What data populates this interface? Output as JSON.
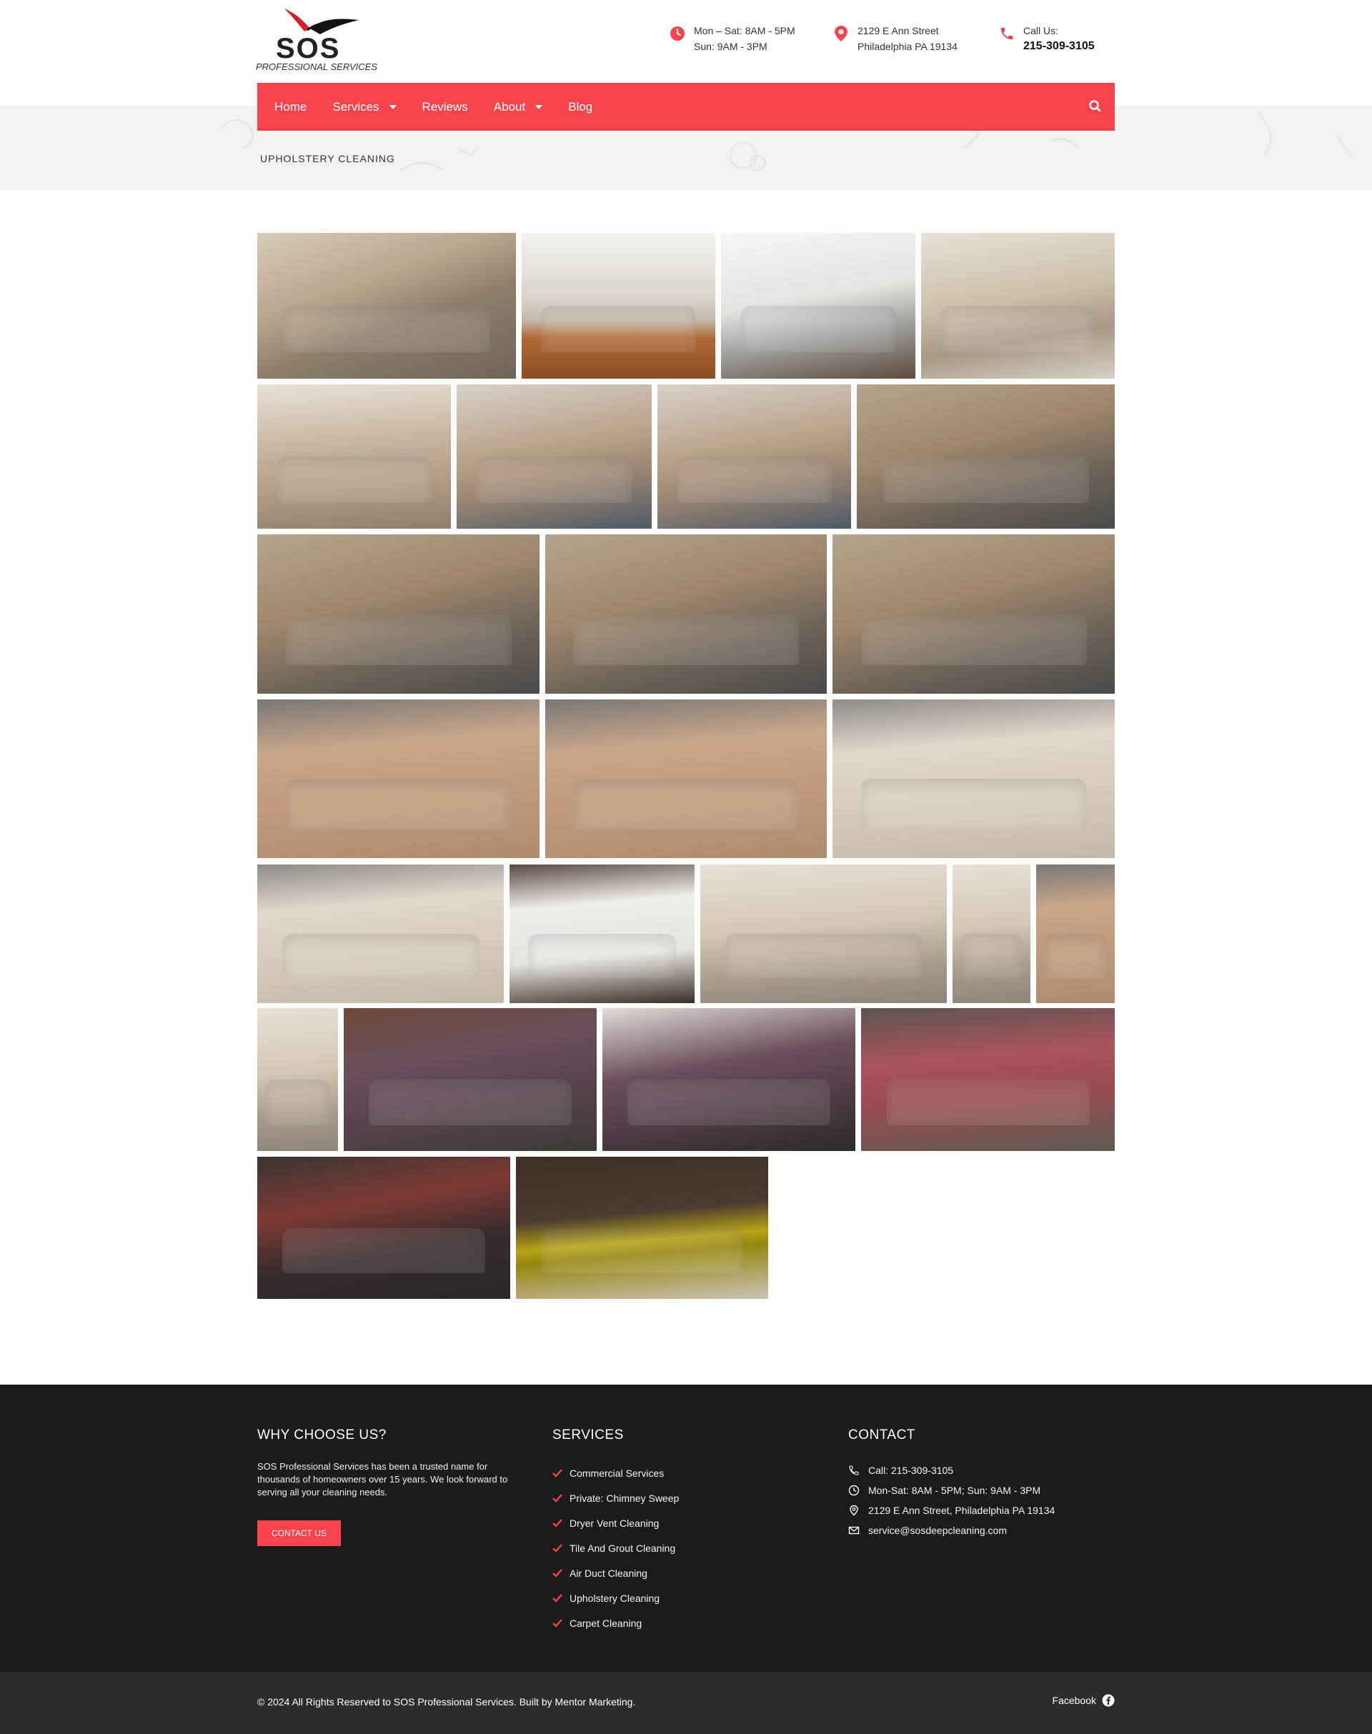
{
  "brand": {
    "name": "SOS",
    "tagline": "PROFESSIONAL SERVICES",
    "accent": "#f7434b"
  },
  "header": {
    "hours": {
      "line1": "Mon – Sat: 8AM - 5PM",
      "line2": "Sun: 9AM - 3PM",
      "icon": "clock-icon"
    },
    "address": {
      "line1": "2129 E Ann Street",
      "line2": "Philadelphia PA 19134",
      "icon": "map-pin-icon"
    },
    "call": {
      "line1": "Call Us:",
      "line2": "215-309-3105",
      "icon": "phone-icon"
    }
  },
  "nav": {
    "items": [
      {
        "label": "Home",
        "dropdown": false
      },
      {
        "label": "Services",
        "dropdown": true
      },
      {
        "label": "Reviews",
        "dropdown": false
      },
      {
        "label": "About",
        "dropdown": true
      },
      {
        "label": "Blog",
        "dropdown": false
      }
    ],
    "search_icon": "search-icon"
  },
  "page": {
    "breadcrumb": "UPHOLSTERY CLEANING"
  },
  "gallery": {
    "photos": [
      {
        "subject": "Technician vacuuming beige sectional"
      },
      {
        "subject": "Tufted grey sofa on hardwood floor"
      },
      {
        "subject": "Technician cleaning white mattress"
      },
      {
        "subject": "Technician cleaning beige sofa"
      },
      {
        "subject": "Beige sofa after cleaning"
      },
      {
        "subject": "Technician cleaning loveseat"
      },
      {
        "subject": "Technician cleaning loveseat cushion"
      },
      {
        "subject": "Technician cleaning sectional back"
      },
      {
        "subject": "Technician cleaning sectional"
      },
      {
        "subject": "Technician cleaning sectional"
      },
      {
        "subject": "Technician cleaning sectional"
      },
      {
        "subject": "Beige sofa seats"
      },
      {
        "subject": "Beige sofa seats"
      },
      {
        "subject": "Light beige sofa seats"
      },
      {
        "subject": "Beige sectional sofa"
      },
      {
        "subject": "White mattress"
      },
      {
        "subject": "Light beige sectional"
      },
      {
        "subject": "Armchair with cushions"
      },
      {
        "subject": "Beige armchair"
      },
      {
        "subject": "Living room chair"
      },
      {
        "subject": "Purple sectional sofa"
      },
      {
        "subject": "Purple sofa with pillows"
      },
      {
        "subject": "Red tufted sofa"
      },
      {
        "subject": "Dark sectional sofa"
      },
      {
        "subject": "Yellow built-in bench seat"
      }
    ]
  },
  "footer": {
    "why": {
      "title": "WHY CHOOSE US?",
      "text": "SOS Professional Services has been a trusted name for thousands of homeowners over 15 years. We look forward to serving all your cleaning needs.",
      "button": "CONTACT US"
    },
    "services": {
      "title": "SERVICES",
      "items": [
        "Commercial Services",
        "Private: Chimney Sweep",
        "Dryer Vent Cleaning",
        "Tile And Grout Cleaning",
        "Air Duct Cleaning",
        "Upholstery Cleaning",
        "Carpet Cleaning"
      ]
    },
    "contact": {
      "title": "CONTACT",
      "items": [
        {
          "icon": "phone-icon",
          "text": "Call: 215-309-3105"
        },
        {
          "icon": "clock-icon",
          "text": "Mon-Sat: 8AM - 5PM; Sun: 9AM - 3PM"
        },
        {
          "icon": "location-icon",
          "text": "2129 E Ann Street, Philadelphia PA 19134"
        },
        {
          "icon": "envelope-icon",
          "text": "service@sosdeepcleaning.com"
        }
      ]
    },
    "copyright": "© 2024 All Rights Reserved to SOS Professional Services. Built by Mentor Marketing.",
    "social": {
      "label": "Facebook",
      "icon": "facebook-icon"
    }
  }
}
